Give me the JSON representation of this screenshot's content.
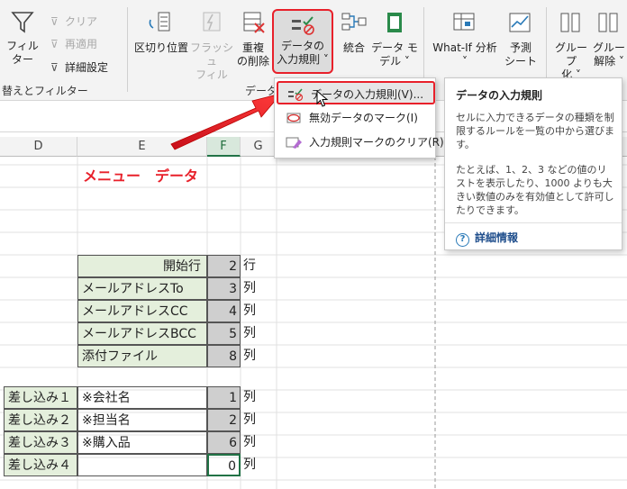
{
  "ribbon": {
    "filter": "フィルター",
    "clear": "クリア",
    "reapply": "再適用",
    "advanced": "詳細設定",
    "sort_filter_group": "替えとフィルター",
    "text_to_columns": "区切り位置",
    "flash_fill_l1": "フラッシュ",
    "flash_fill_l2": "フィル",
    "remove_dup_l1": "重複",
    "remove_dup_l2": "の削除",
    "data_validation_l1": "データの",
    "data_validation_l2": "入力規則",
    "consolidate": "統合",
    "data_model_l1": "データ モ",
    "data_model_l2": "デル",
    "data_tools_group": "データ",
    "whatif": "What-If 分析",
    "forecast_l1": "予測",
    "forecast_l2": "シート",
    "group_l1": "グループ",
    "group_l2": "化",
    "ungroup_l1": "グルー",
    "ungroup_l2": "解除"
  },
  "menu": {
    "items": [
      {
        "label": "データの入力規則(V)..."
      },
      {
        "label": "無効データのマーク(I)"
      },
      {
        "label": "入力規則マークのクリア(R)"
      }
    ]
  },
  "tooltip": {
    "title": "データの入力規則",
    "p1": "セルに入力できるデータの種類を制限するルールを一覧の中から選びます。",
    "p2": "たとえば、1、2、3 などの値のリストを表示したり、1000 よりも大きい数値のみを有効値として許可したりできます。",
    "more": "詳細情報"
  },
  "sheet": {
    "columns": [
      "D",
      "E",
      "F",
      "G"
    ],
    "title": "メニュー　データ",
    "config": [
      {
        "label": "開始行",
        "value": "2",
        "unit": "行"
      },
      {
        "label": "メールアドレスTo",
        "value": "3",
        "unit": "列"
      },
      {
        "label": "メールアドレスCC",
        "value": "4",
        "unit": "列"
      },
      {
        "label": "メールアドレスBCC",
        "value": "5",
        "unit": "列"
      },
      {
        "label": "添付ファイル",
        "value": "8",
        "unit": "列"
      }
    ],
    "merge": [
      {
        "label": "差し込み１",
        "name": "※会社名",
        "value": "1",
        "unit": "列"
      },
      {
        "label": "差し込み２",
        "name": "※担当名",
        "value": "2",
        "unit": "列"
      },
      {
        "label": "差し込み３",
        "name": "※購入品",
        "value": "6",
        "unit": "列"
      },
      {
        "label": "差し込み４",
        "name": "",
        "value": "0",
        "unit": "列"
      }
    ]
  },
  "colors": {
    "accent_red": "#e8202a",
    "excel_green": "#217346",
    "title_red": "#e8202a"
  }
}
